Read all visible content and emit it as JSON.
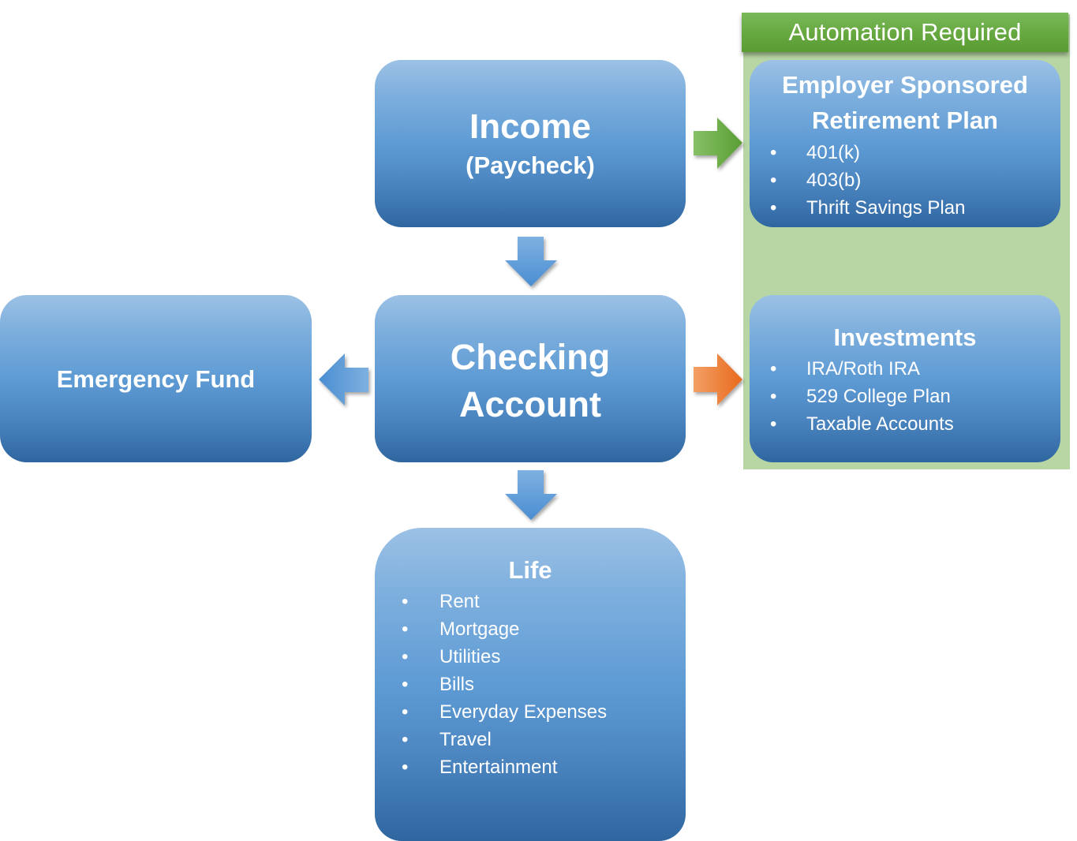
{
  "automation_panel": {
    "header": "Automation Required",
    "header_color": "#6aaa42",
    "background_color": "#b8d6a4"
  },
  "nodes": {
    "income": {
      "title": "Income",
      "subtitle": "(Paycheck)"
    },
    "checking": {
      "title_line1": "Checking",
      "title_line2": "Account"
    },
    "emergency": {
      "title": "Emergency Fund"
    },
    "retirement": {
      "title_line1": "Employer Sponsored",
      "title_line2": "Retirement Plan",
      "items": [
        "401(k)",
        "403(b)",
        "Thrift Savings Plan"
      ]
    },
    "investments": {
      "title": "Investments",
      "items": [
        "IRA/Roth IRA",
        "529 College Plan",
        "Taxable Accounts"
      ]
    },
    "life": {
      "title": "Life",
      "items": [
        "Rent",
        "Mortgage",
        "Utilities",
        "Bills",
        "Everyday Expenses",
        "Travel",
        "Entertainment"
      ]
    }
  },
  "bullet_glyph": "•",
  "arrows": [
    {
      "from": "income",
      "to": "retirement",
      "direction": "right",
      "color": "#62a83a"
    },
    {
      "from": "income",
      "to": "checking",
      "direction": "down",
      "color": "#4f90d4"
    },
    {
      "from": "checking",
      "to": "emergency",
      "direction": "left",
      "color": "#4f90d4"
    },
    {
      "from": "checking",
      "to": "investments",
      "direction": "right",
      "color": "#ee7320"
    },
    {
      "from": "checking",
      "to": "life",
      "direction": "down",
      "color": "#4f90d4"
    }
  ],
  "colors": {
    "box_top": "#9cc1e5",
    "box_bottom": "#2e66a0",
    "text": "#ffffff"
  }
}
